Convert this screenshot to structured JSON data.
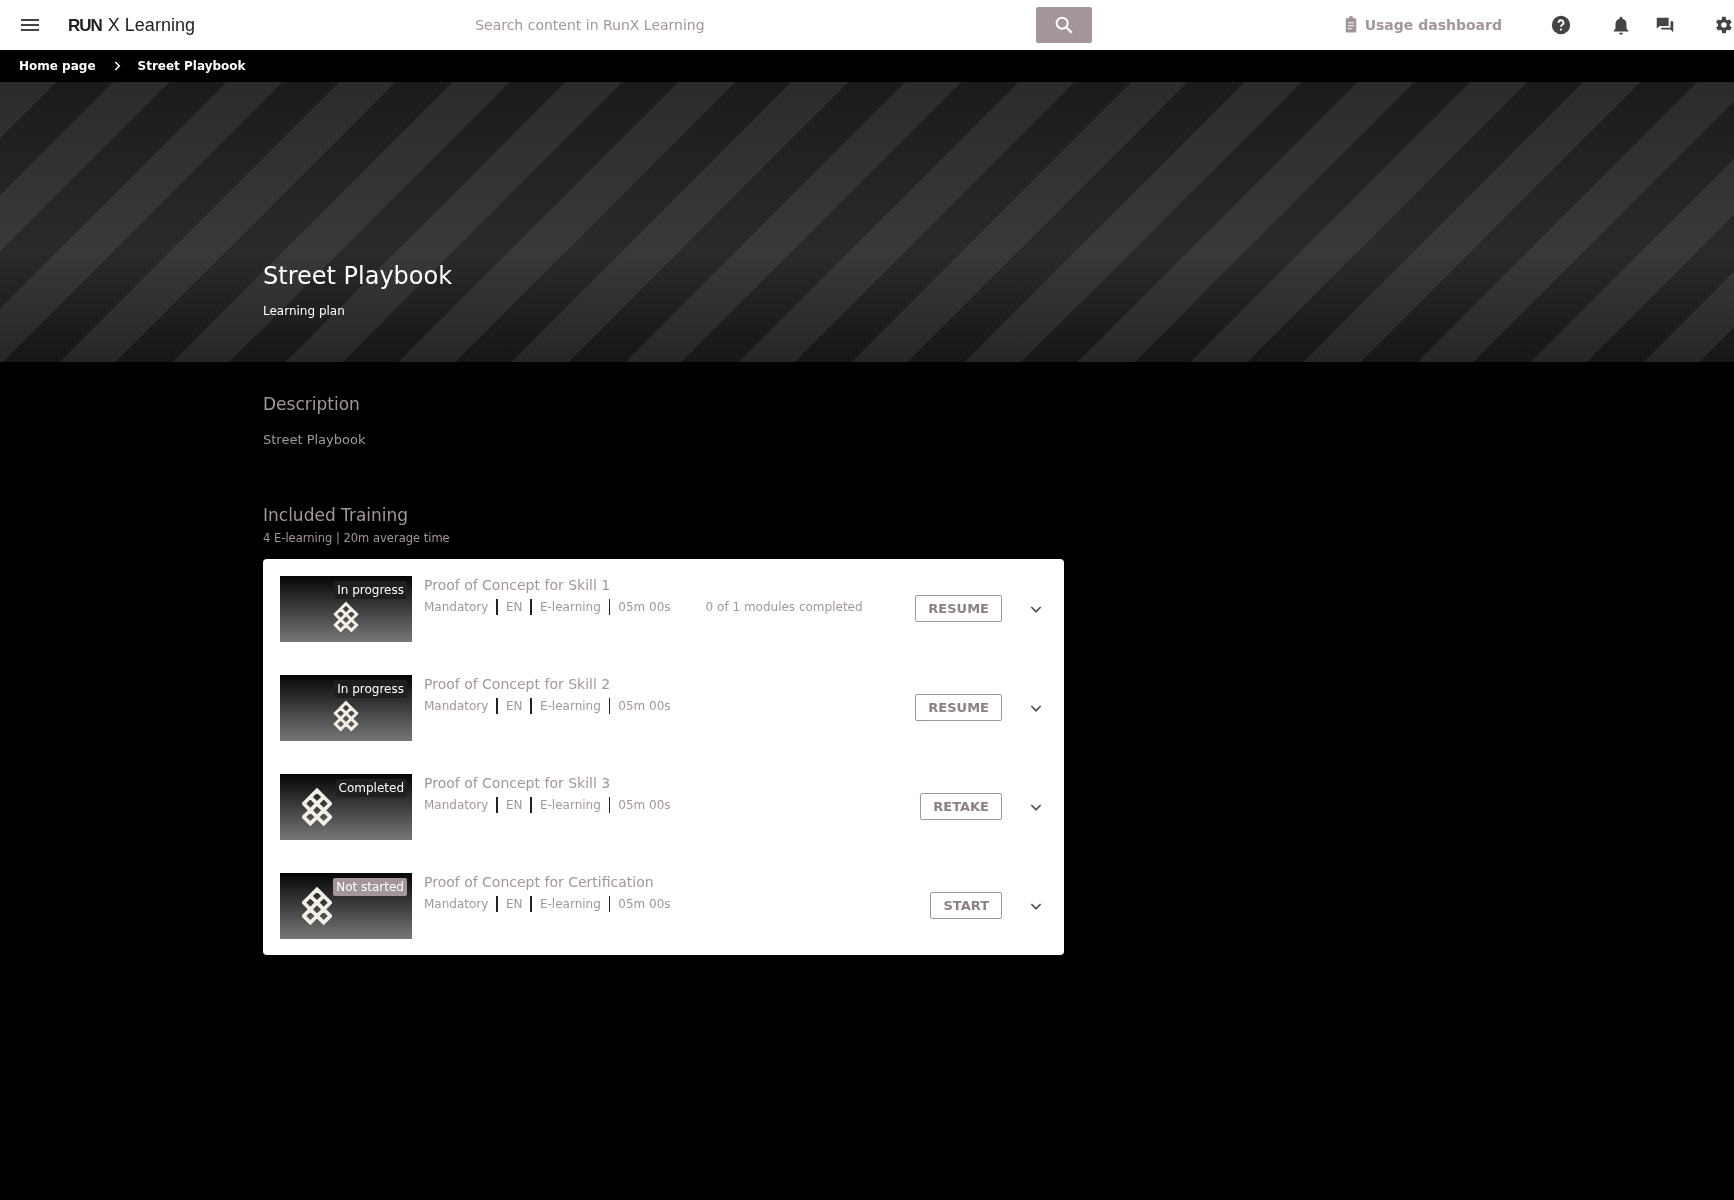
{
  "header": {
    "logo_mark": "RUN",
    "logo_text": "X Learning",
    "search": {
      "placeholder": "Search content in RunX Learning"
    },
    "usage_dashboard": "Usage dashboard"
  },
  "breadcrumbs": [
    {
      "label": "Home page"
    },
    {
      "label": "Street Playbook"
    }
  ],
  "hero": {
    "title": "Street Playbook",
    "subtitle": "Learning plan"
  },
  "description": {
    "heading": "Description",
    "text": "Street Playbook"
  },
  "included_training": {
    "heading": "Included Training",
    "summary": "4 E-learning | 20m average time",
    "items": [
      {
        "title": "Proof of Concept for Skill 1",
        "kind": "partial",
        "status_label": "In progress",
        "meta": [
          "Mandatory",
          "EN",
          "E-learning",
          "05m 00s"
        ],
        "progress": "0 of 1 modules completed",
        "action": "RESUME"
      },
      {
        "title": "Proof of Concept for Skill 2",
        "kind": "partial",
        "status_label": "In progress",
        "meta": [
          "Mandatory",
          "EN",
          "E-learning",
          "05m 00s"
        ],
        "action": "RESUME"
      },
      {
        "title": "Proof of Concept for Skill 3",
        "kind": "done",
        "status_label": "Completed",
        "meta": [
          "Mandatory",
          "EN",
          "E-learning",
          "05m 00s"
        ],
        "action": "RETAKE"
      },
      {
        "title": "Proof of Concept for Certification",
        "kind": "new",
        "status_label": "Not started",
        "meta": [
          "Mandatory",
          "EN",
          "E-learning",
          "05m 00s"
        ],
        "action": "START"
      }
    ]
  }
}
